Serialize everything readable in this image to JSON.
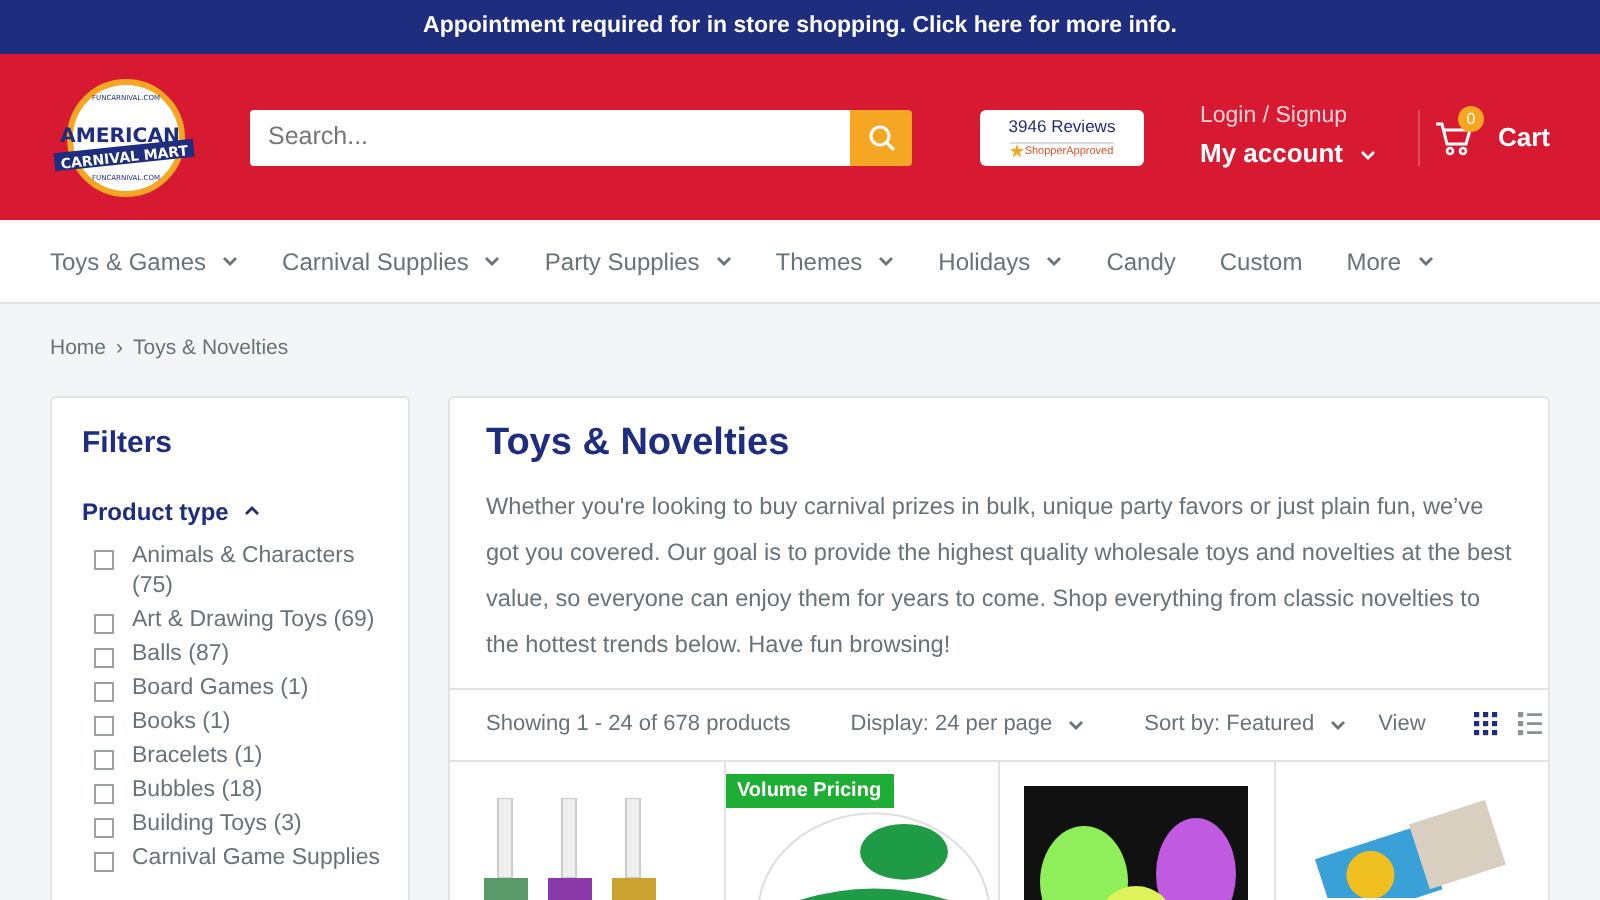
{
  "announcement": "Appointment required for in store shopping. Click here for more info.",
  "logo": {
    "top": "FUNCARNIVAL.COM",
    "word1": "AMERICAN",
    "word2": "CARNIVAL MART",
    "bottom": "FUNCARNIVAL.COM"
  },
  "search": {
    "placeholder": "Search..."
  },
  "reviews": {
    "count": "3946 Reviews",
    "brand": "ShopperApproved"
  },
  "account": {
    "login": "Login / Signup",
    "label": "My account"
  },
  "cart": {
    "count": "0",
    "label": "Cart"
  },
  "nav": [
    {
      "label": "Toys & Games",
      "dropdown": true
    },
    {
      "label": "Carnival Supplies",
      "dropdown": true
    },
    {
      "label": "Party Supplies",
      "dropdown": true
    },
    {
      "label": "Themes",
      "dropdown": true
    },
    {
      "label": "Holidays",
      "dropdown": true
    },
    {
      "label": "Candy",
      "dropdown": false
    },
    {
      "label": "Custom",
      "dropdown": false
    },
    {
      "label": "More",
      "dropdown": true
    }
  ],
  "breadcrumb": {
    "items": [
      "Home",
      "Toys & Novelties"
    ],
    "separator": "›"
  },
  "filters": {
    "title": "Filters",
    "group": "Product type",
    "expanded": true,
    "items": [
      {
        "label": "Animals & Characters (75)",
        "checked": false
      },
      {
        "label": "Art & Drawing Toys (69)",
        "checked": false
      },
      {
        "label": "Balls (87)",
        "checked": false
      },
      {
        "label": "Board Games (1)",
        "checked": false
      },
      {
        "label": "Books (1)",
        "checked": false
      },
      {
        "label": "Bracelets (1)",
        "checked": false
      },
      {
        "label": "Bubbles (18)",
        "checked": false
      },
      {
        "label": "Building Toys (3)",
        "checked": false
      },
      {
        "label": "Carnival Game Supplies",
        "checked": false
      }
    ]
  },
  "collection": {
    "title": "Toys & Novelties",
    "description": "Whether you're looking to buy carnival prizes in bulk, unique party favors or just plain fun, we’ve got you covered. Our goal is to provide the highest quality wholesale toys and novelties at the best value, so everyone can enjoy them for years to come. Shop everything from classic novelties to the hottest trends below. Have fun browsing!"
  },
  "toolbar": {
    "showing": "Showing 1 - 24 of 678 products",
    "display": "Display: 24 per page",
    "sort": "Sort by: Featured",
    "view": "View",
    "views": [
      {
        "kind": "grid",
        "selected": true
      },
      {
        "kind": "list",
        "selected": false
      }
    ]
  },
  "products": [
    {
      "kind": "horns"
    },
    {
      "kind": "ball",
      "badge": "Volume Pricing"
    },
    {
      "kind": "glow"
    },
    {
      "kind": "snaps"
    }
  ]
}
